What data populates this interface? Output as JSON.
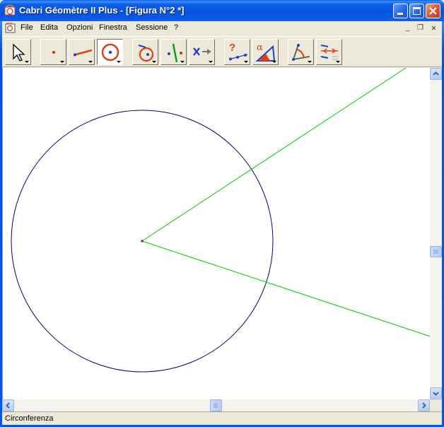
{
  "window": {
    "title": "Cabri Géomètre II Plus - [Figura N°2 *]"
  },
  "menu": {
    "items": [
      {
        "label": "File"
      },
      {
        "label": "Edita"
      },
      {
        "label": "Opzioni"
      },
      {
        "label": "Finestra"
      },
      {
        "label": "Sessione"
      },
      {
        "label": "?"
      }
    ],
    "mdi_minimize": "_",
    "mdi_restore": "❐",
    "mdi_close": "×"
  },
  "toolbar": {
    "tools": [
      {
        "name": "pointer-tool-icon"
      },
      {
        "name": "point-tool-icon"
      },
      {
        "name": "line-tool-icon"
      },
      {
        "name": "circle-tool-icon",
        "active": true
      },
      {
        "name": "construct-tool-icon"
      },
      {
        "name": "perpendicular-tool-icon"
      },
      {
        "name": "transform-tool-icon"
      },
      {
        "name": "check-property-tool-icon"
      },
      {
        "name": "measure-tool-icon"
      },
      {
        "name": "display-tool-icon"
      },
      {
        "name": "drawing-tool-icon"
      }
    ]
  },
  "figure": {
    "circle_color": "#000080",
    "ray_color": "#00cc00",
    "center_point_color": "#cc0000"
  },
  "status": {
    "text": "Circonferenza"
  }
}
